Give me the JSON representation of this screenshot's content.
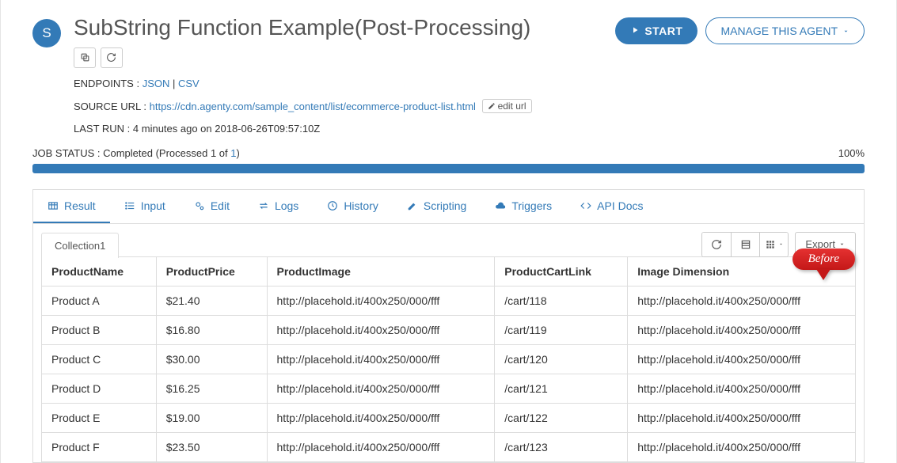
{
  "avatar_letter": "S",
  "title": "SubString Function Example(Post-Processing)",
  "endpoints_label": "ENDPOINTS :",
  "endpoints": {
    "json": "JSON",
    "csv": "CSV"
  },
  "source_url_label": "SOURCE URL :",
  "source_url": "https://cdn.agenty.com/sample_content/list/ecommerce-product-list.html",
  "edit_url_label": "edit url",
  "last_run_label": "LAST RUN :",
  "last_run_value": "4 minutes ago on 2018-06-26T09:57:10Z",
  "start_label": "START",
  "manage_label": "MANAGE THIS AGENT",
  "job_status_label": "JOB STATUS :",
  "job_status_value": "Completed (Processed 1 of ",
  "job_status_link": "1",
  "job_status_close": ")",
  "progress_pct": "100%",
  "tabs": {
    "result": "Result",
    "input": "Input",
    "edit": "Edit",
    "logs": "Logs",
    "history": "History",
    "scripting": "Scripting",
    "triggers": "Triggers",
    "apidocs": "API Docs"
  },
  "collection_tab": "Collection1",
  "export_label": "Export",
  "callout_text": "Before",
  "table": {
    "headers": [
      "ProductName",
      "ProductPrice",
      "ProductImage",
      "ProductCartLink",
      "Image Dimension"
    ],
    "rows": [
      [
        "Product A",
        "$21.40",
        "http://placehold.it/400x250/000/fff",
        "/cart/118",
        "http://placehold.it/400x250/000/fff"
      ],
      [
        "Product B",
        "$16.80",
        "http://placehold.it/400x250/000/fff",
        "/cart/119",
        "http://placehold.it/400x250/000/fff"
      ],
      [
        "Product C",
        "$30.00",
        "http://placehold.it/400x250/000/fff",
        "/cart/120",
        "http://placehold.it/400x250/000/fff"
      ],
      [
        "Product D",
        "$16.25",
        "http://placehold.it/400x250/000/fff",
        "/cart/121",
        "http://placehold.it/400x250/000/fff"
      ],
      [
        "Product E",
        "$19.00",
        "http://placehold.it/400x250/000/fff",
        "/cart/122",
        "http://placehold.it/400x250/000/fff"
      ],
      [
        "Product F",
        "$23.50",
        "http://placehold.it/400x250/000/fff",
        "/cart/123",
        "http://placehold.it/400x250/000/fff"
      ]
    ]
  }
}
